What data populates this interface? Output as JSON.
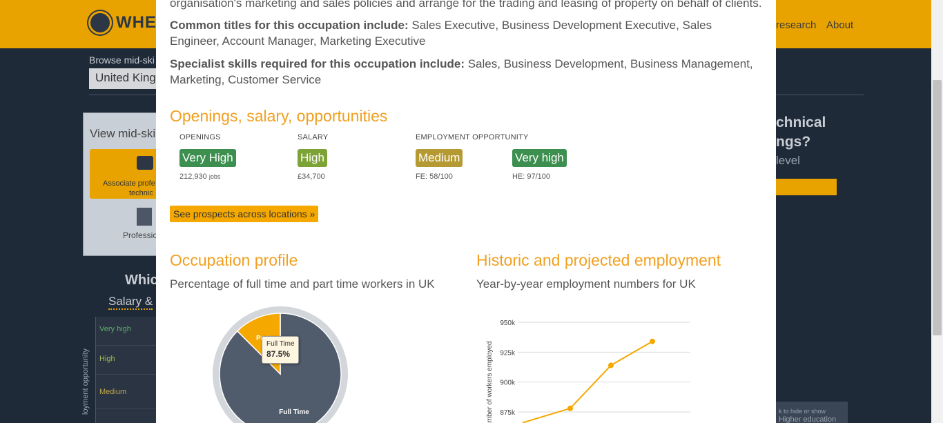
{
  "background": {
    "logo_text": "WHER",
    "nav": [
      "research",
      "About"
    ],
    "browse_label": "Browse mid-ski",
    "browse_value": "United King",
    "panel_title": "View mid-ski",
    "card_label_1": "Associate profe",
    "card_label_2": "technic",
    "prof_label": "Professio",
    "which_heading": "Whic",
    "salary_tab": "Salary & ",
    "grid_rows": [
      "Very high",
      "High",
      "Medium"
    ],
    "axis_label": "loyment opportunity",
    "right_title_1": "chnical",
    "right_title_2": "ngs?",
    "right_level": "level",
    "toggle_hint": "k to hide or show",
    "toggle_label": "Higher education"
  },
  "modal": {
    "intro_line": "organisation's marketing and sales policies and arrange for the trading and leasing of property on behalf of clients.",
    "titles_label": "Common titles for this occupation include:",
    "titles_value": "Sales Executive, Business Development Executive, Sales Engineer, Account Manager, Marketing Executive",
    "skills_label": "Specialist skills required for this occupation include:",
    "skills_value": "Sales, Business Development, Business Management, Marketing, Customer Service",
    "section_title": "Openings, salary, opportunities",
    "openings": {
      "header": "OPENINGS",
      "badge": "Very High",
      "value": "212,930",
      "unit": "jobs",
      "color": "#3c8f4f"
    },
    "salary": {
      "header": "SALARY",
      "badge": "High",
      "value": "£34,700",
      "color": "#7da336"
    },
    "opportunity": {
      "header": "EMPLOYMENT OPPORTUNITY",
      "fe_badge": "Medium",
      "fe_value": "FE: 58/100",
      "fe_color": "#b59a33",
      "he_badge": "Very high",
      "he_value": "HE: 97/100",
      "he_color": "#3c8f4f"
    },
    "prospects_button": "See prospects across locations »",
    "profile_title": "Occupation profile",
    "profile_subtitle": "Percentage of full time and part time workers in UK",
    "employment_title": "Historic and projected employment",
    "employment_subtitle": "Year-by-year employment numbers for UK",
    "tooltip": {
      "label": "Full Time",
      "value": "87.5%"
    }
  },
  "chart_data": [
    {
      "type": "pie",
      "categories": [
        "Full Time",
        "Part Time"
      ],
      "values": [
        87.5,
        12.5
      ],
      "colors": [
        "#505b6b",
        "#f5a800"
      ],
      "labels": [
        "Full Time",
        "Part"
      ]
    },
    {
      "type": "line",
      "ylabel": "Number of workers employed",
      "yticks": [
        "950k",
        "925k",
        "900k",
        "875k"
      ],
      "ylim": [
        875000,
        950000
      ],
      "grid": true,
      "series": [
        {
          "values": [
            866000,
            878000,
            914000,
            934000
          ],
          "color": "#f5a800"
        }
      ]
    }
  ]
}
